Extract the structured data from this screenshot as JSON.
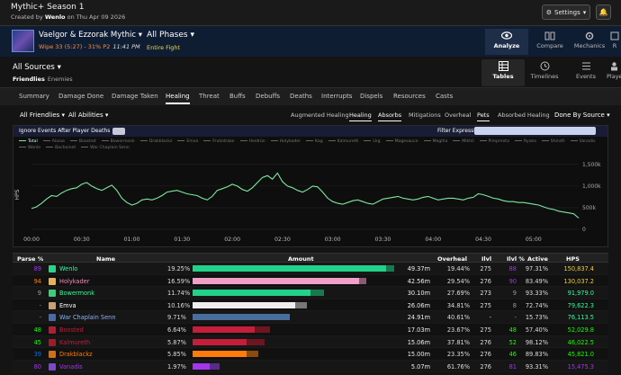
{
  "header": {
    "title": "Mythic+ Season 1",
    "created_prefix": "Created by",
    "creator": "Wenlo",
    "created_date": "on Thu Apr 09 2026",
    "settings_label": "Settings"
  },
  "fight": {
    "boss_name": "Vaelgor & Ezzorak Mythic",
    "wipe_text": "Wipe 33 (5:27) - 31% P2",
    "time": "11:41 PM",
    "phase_title": "All Phases",
    "phase_sub": "Entire Fight"
  },
  "top_nav": [
    {
      "label": "Analyze",
      "icon": "eye-icon",
      "active": true
    },
    {
      "label": "Compare",
      "icon": "compare-icon",
      "active": false
    },
    {
      "label": "Mechanics",
      "icon": "mechanics-icon",
      "active": false
    },
    {
      "label": "R",
      "icon": "report-icon",
      "active": false
    }
  ],
  "sources": {
    "title": "All Sources",
    "friendlies": "Friendlies",
    "enemies": "Enemies"
  },
  "view_nav": [
    {
      "label": "Tables",
      "icon": "table-icon",
      "active": true
    },
    {
      "label": "Timelines",
      "icon": "timeline-icon",
      "active": false
    },
    {
      "label": "Events",
      "icon": "events-icon",
      "active": false
    },
    {
      "label": "Players",
      "icon": "players-icon",
      "active": false
    }
  ],
  "tabs": [
    "Summary",
    "Damage Done",
    "Damage Taken",
    "Healing",
    "Threat",
    "Buffs",
    "Debuffs",
    "Deaths",
    "Interrupts",
    "Dispels",
    "Resources",
    "Casts"
  ],
  "active_tab": "Healing",
  "filters": {
    "friendlies": "All Friendlies",
    "abilities": "All Abilities",
    "sub_tabs": [
      "Augmented Healing",
      "Healing",
      "Absorbs",
      "Mitigations",
      "Overheal",
      "Pets",
      "Absorbed Healing"
    ],
    "active_sub": [
      "Healing",
      "Pets"
    ],
    "group_by": "Done By Source"
  },
  "panel": {
    "ignore_label": "Ignore Events After Player Deaths",
    "filter_label": "Filter Expression:"
  },
  "legend": [
    "Total",
    "Alaiaa",
    "Boosted",
    "Bowermonk",
    "Drakblackz",
    "Emva",
    "Frutzdrake",
    "Heidrün",
    "Holykader",
    "Kag",
    "Kalmureth",
    "Lkg",
    "Magesauce",
    "Magiha",
    "Mikhil",
    "Pimpmeta",
    "Ryoka",
    "Shindh",
    "Vanadis",
    "Wenlo",
    "Bachoinet",
    "War Chaplain Senn"
  ],
  "chart_data": {
    "type": "line",
    "title": "",
    "xlabel": "",
    "ylabel": "HPS",
    "x_ticks": [
      "00:00",
      "00:30",
      "01:00",
      "01:30",
      "02:00",
      "02:30",
      "03:00",
      "03:30",
      "04:00",
      "04:30",
      "05:00"
    ],
    "y_ticks": [
      "0",
      "500k",
      "1,000k",
      "1,500k"
    ],
    "ylim": [
      0,
      1600000
    ],
    "xlim": [
      0,
      327
    ],
    "series": [
      {
        "name": "Total",
        "color": "#7de8a0",
        "x": [
          0,
          3,
          6,
          9,
          12,
          15,
          18,
          21,
          24,
          27,
          30,
          33,
          36,
          39,
          42,
          45,
          48,
          51,
          54,
          57,
          60,
          63,
          66,
          69,
          72,
          75,
          78,
          81,
          84,
          87,
          90,
          93,
          96,
          99,
          102,
          105,
          108,
          111,
          114,
          117,
          120,
          123,
          126,
          129,
          132,
          135,
          138,
          141,
          144,
          147,
          150,
          153,
          156,
          159,
          162,
          165,
          168,
          171,
          174,
          177,
          180,
          183,
          186,
          189,
          192,
          195,
          198,
          201,
          204,
          207,
          210,
          213,
          216,
          219,
          222,
          225,
          228,
          231,
          234,
          237,
          240,
          243,
          246,
          249,
          252,
          255,
          258,
          261,
          264,
          267,
          270,
          273,
          276,
          279,
          282,
          285,
          288,
          291,
          294,
          297,
          300,
          303,
          306,
          309,
          312,
          315,
          318,
          321,
          324,
          327
        ],
        "values": [
          480000,
          520000,
          600000,
          700000,
          780000,
          760000,
          840000,
          900000,
          940000,
          960000,
          1040000,
          1080000,
          1000000,
          940000,
          900000,
          960000,
          1020000,
          900000,
          720000,
          620000,
          560000,
          600000,
          680000,
          700000,
          680000,
          720000,
          780000,
          860000,
          880000,
          900000,
          860000,
          820000,
          800000,
          780000,
          720000,
          680000,
          760000,
          900000,
          940000,
          980000,
          1040000,
          1000000,
          920000,
          880000,
          960000,
          1080000,
          1200000,
          1240000,
          1160000,
          1300000,
          1100000,
          1000000,
          960000,
          900000,
          860000,
          920000,
          1000000,
          980000,
          860000,
          720000,
          640000,
          600000,
          580000,
          620000,
          660000,
          680000,
          640000,
          600000,
          580000,
          640000,
          700000,
          720000,
          740000,
          760000,
          720000,
          700000,
          680000,
          700000,
          740000,
          760000,
          720000,
          680000,
          700000,
          720000,
          720000,
          700000,
          680000,
          720000,
          740000,
          820000,
          800000,
          760000,
          720000,
          700000,
          660000,
          640000,
          640000,
          620000,
          620000,
          600000,
          580000,
          560000,
          520000,
          480000,
          460000,
          420000,
          400000,
          380000,
          360000,
          260000
        ]
      }
    ]
  },
  "table": {
    "headers": [
      "Parse %",
      "Name",
      "Amount",
      "Overheal",
      "Ilvl",
      "Ilvl %",
      "Active",
      "HPS"
    ],
    "rows": [
      {
        "parse": "89",
        "parse_color": "#a335ee",
        "name": "Wenlo",
        "name_color": "#33ff99",
        "icon_color": "#2ad48a",
        "pct": "19.25%",
        "amount": "49.37m",
        "fill": 1.0,
        "fill_color": "#22d28a",
        "over_fill": 0.04,
        "over_color": "#187a50",
        "overheal": "19.44%",
        "ilvl": "275",
        "ilvl_pct": "88",
        "ilvl_pct_color": "#a335ee",
        "active": "97.31%",
        "hps": "150,837.4",
        "hps_color": "#f0d040"
      },
      {
        "parse": "94",
        "parse_color": "#ff8000",
        "name": "Holykader",
        "name_color": "#f48cba",
        "icon_color": "#e8b05a",
        "pct": "16.59%",
        "amount": "42.56m",
        "fill": 0.86,
        "fill_color": "#f0a0c8",
        "over_fill": 0.04,
        "over_color": "#8a5a70",
        "overheal": "29.54%",
        "ilvl": "276",
        "ilvl_pct": "90",
        "ilvl_pct_color": "#a335ee",
        "active": "83.49%",
        "hps": "130,037.2",
        "hps_color": "#f0d040"
      },
      {
        "parse": "9",
        "parse_color": "#9d9d9d",
        "name": "Bowermonk",
        "name_color": "#33ff99",
        "icon_color": "#3dcc78",
        "pct": "11.74%",
        "amount": "30.10m",
        "fill": 0.61,
        "fill_color": "#22d28a",
        "over_fill": 0.07,
        "over_color": "#187a50",
        "overheal": "27.69%",
        "ilvl": "273",
        "ilvl_pct": "9",
        "ilvl_pct_color": "#9d9d9d",
        "active": "93.33%",
        "hps": "91,979.0",
        "hps_color": "#33ff99"
      },
      {
        "parse": "-",
        "parse_color": "#9d9d9d",
        "name": "Emva",
        "name_color": "#ffffff",
        "icon_color": "#c9a070",
        "pct": "10.16%",
        "amount": "26.06m",
        "fill": 0.53,
        "fill_color": "#eeeeee",
        "over_fill": 0.06,
        "over_color": "#777777",
        "overheal": "34.81%",
        "ilvl": "275",
        "ilvl_pct": "8",
        "ilvl_pct_color": "#9d9d9d",
        "active": "72.74%",
        "hps": "79,622.3",
        "hps_color": "#33ff99"
      },
      {
        "parse": "-",
        "parse_color": "#9d9d9d",
        "name": "War Chaplain Senn",
        "name_color": "#8ab4ff",
        "icon_color": "#4a6aa8",
        "pct": "9.71%",
        "amount": "24.91m",
        "fill": 0.5,
        "fill_color": "#4a6e9c",
        "over_fill": 0.0,
        "over_color": "#2e4460",
        "overheal": "40.61%",
        "ilvl": "-",
        "ilvl_pct": "-",
        "ilvl_pct_color": "#9d9d9d",
        "active": "15.73%",
        "hps": "76,113.5",
        "hps_color": "#33ff99"
      },
      {
        "parse": "48",
        "parse_color": "#1eff00",
        "name": "Boosted",
        "name_color": "#c41e3a",
        "icon_color": "#b02030",
        "pct": "6.64%",
        "amount": "17.03m",
        "fill": 0.32,
        "fill_color": "#c41e3a",
        "over_fill": 0.08,
        "over_color": "#6e1522",
        "overheal": "23.67%",
        "ilvl": "275",
        "ilvl_pct": "48",
        "ilvl_pct_color": "#1eff00",
        "active": "57.40%",
        "hps": "52,029.8",
        "hps_color": "#1eff00"
      },
      {
        "parse": "45",
        "parse_color": "#1eff00",
        "name": "Kalmureth",
        "name_color": "#c41e3a",
        "icon_color": "#a01c2c",
        "pct": "5.87%",
        "amount": "15.06m",
        "fill": 0.28,
        "fill_color": "#c41e3a",
        "over_fill": 0.09,
        "over_color": "#6e1522",
        "overheal": "37.81%",
        "ilvl": "276",
        "ilvl_pct": "52",
        "ilvl_pct_color": "#1eff00",
        "active": "98.12%",
        "hps": "46,022.5",
        "hps_color": "#1eff00"
      },
      {
        "parse": "39",
        "parse_color": "#0070dd",
        "name": "Drakblackz",
        "name_color": "#ff7c0a",
        "icon_color": "#d0701a",
        "pct": "5.85%",
        "amount": "15.00m",
        "fill": 0.28,
        "fill_color": "#ff7c0a",
        "over_fill": 0.06,
        "over_color": "#8a4a10",
        "overheal": "23.35%",
        "ilvl": "276",
        "ilvl_pct": "46",
        "ilvl_pct_color": "#1eff00",
        "active": "89.83%",
        "hps": "45,821.0",
        "hps_color": "#1eff00"
      },
      {
        "parse": "80",
        "parse_color": "#a335ee",
        "name": "Vanadis",
        "name_color": "#a335ee",
        "icon_color": "#7a4ac8",
        "pct": "1.97%",
        "amount": "5.07m",
        "fill": 0.09,
        "fill_color": "#a335ee",
        "over_fill": 0.05,
        "over_color": "#5a2a8a",
        "overheal": "61.76%",
        "ilvl": "276",
        "ilvl_pct": "81",
        "ilvl_pct_color": "#a335ee",
        "active": "93.31%",
        "hps": "15,475.3",
        "hps_color": "#a335ee"
      }
    ]
  }
}
